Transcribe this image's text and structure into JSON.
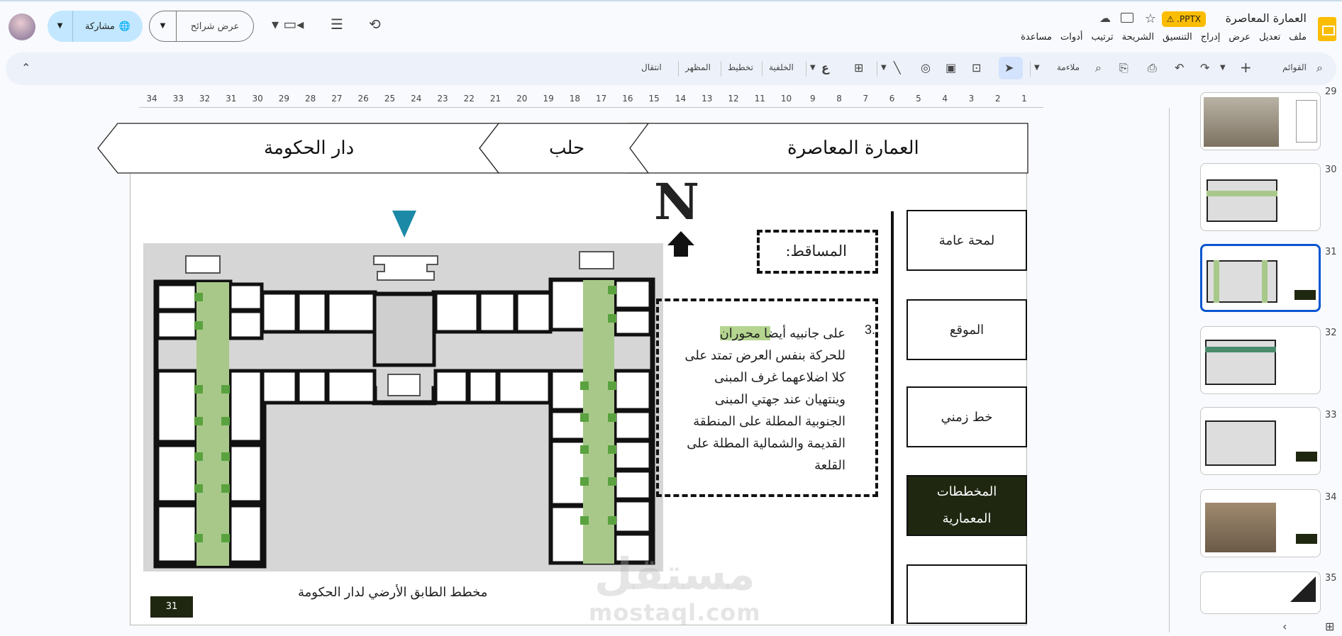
{
  "app": {
    "title": "العمارة المعاصرة",
    "badge": ".PPTX",
    "menu": [
      "ملف",
      "تعديل",
      "عرض",
      "إدراج",
      "التنسيق",
      "الشريحة",
      "ترتيب",
      "أدوات",
      "مساعدة"
    ],
    "share_label": "مشاركة",
    "present_label": "عرض شرائح"
  },
  "toolbar": {
    "menus_label": "القوائم",
    "zoom_label": "ملاءمة",
    "background_label": "الخلفية",
    "layout_label": "تخطيط",
    "theme_label": "المظهر",
    "transition_label": "انتقال"
  },
  "ruler": {
    "ticks": [
      "34",
      "33",
      "32",
      "31",
      "30",
      "29",
      "28",
      "27",
      "26",
      "25",
      "24",
      "23",
      "22",
      "21",
      "20",
      "19",
      "18",
      "17",
      "16",
      "15",
      "14",
      "13",
      "12",
      "11",
      "10",
      "9",
      "8",
      "7",
      "6",
      "5",
      "4",
      "3",
      "2",
      "1"
    ]
  },
  "slide": {
    "ribbon": [
      "العمارة المعاصرة",
      "حلب",
      "دار الحكومة"
    ],
    "north": "N",
    "section_label": ":المساقط",
    "list_number": "3.",
    "body_lines": [
      "على جانبيه أيضا محوران",
      "للحركة بنفس العرض تمتد على",
      "كلا اضلاعهما غرف المبنى",
      "وينتهيان عند جهتي المبنى",
      "الجنوبية المطلة على المنطقة",
      "القديمة والشمالية المطلة على",
      "القلعة"
    ],
    "side_buttons": [
      "لمحة عامة",
      "الموقع",
      "خط زمني",
      "المخططات المعمارية",
      ""
    ],
    "caption": "مخطط الطابق الأرضي لدار الحكومة",
    "page_number": "31"
  },
  "watermark": {
    "arabic": "مستقل",
    "latin": "mostaql.com"
  },
  "thumbnails": [
    {
      "num": "29"
    },
    {
      "num": "30"
    },
    {
      "num": "31"
    },
    {
      "num": "32"
    },
    {
      "num": "33"
    },
    {
      "num": "34"
    },
    {
      "num": "35"
    }
  ],
  "colors": {
    "accent": "#0b57d0",
    "dark_box": "#1f2710",
    "green_axis": "#a8c88a",
    "green_marker": "#5aa23f",
    "north_marker": "#1c8aa6"
  }
}
